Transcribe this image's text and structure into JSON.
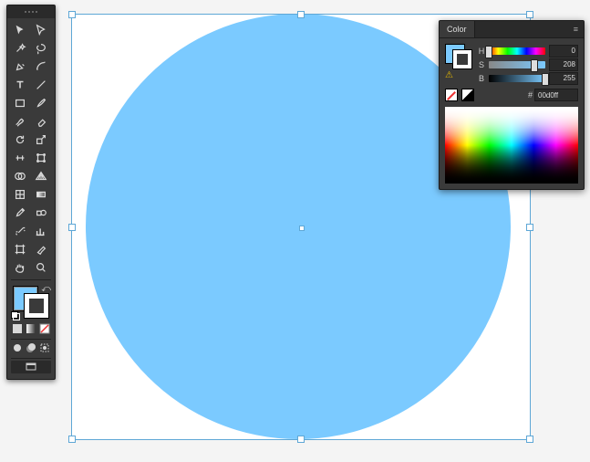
{
  "canvas": {
    "shape": "ellipse",
    "fill_color": "#7bcaff",
    "stroke": "none"
  },
  "toolbar": {
    "rows": [
      [
        "selection-tool",
        "direct-selection-tool"
      ],
      [
        "magic-wand-tool",
        "lasso-tool"
      ],
      [
        "pen-tool",
        "curvature-tool"
      ],
      [
        "type-tool",
        "line-segment-tool"
      ],
      [
        "rectangle-tool",
        "paintbrush-tool"
      ],
      [
        "shaper-tool",
        "eraser-tool"
      ],
      [
        "rotate-tool",
        "scale-tool"
      ],
      [
        "width-tool",
        "free-transform-tool"
      ],
      [
        "shape-builder-tool",
        "perspective-grid-tool"
      ],
      [
        "mesh-tool",
        "gradient-tool"
      ],
      [
        "eyedropper-tool",
        "blend-tool"
      ],
      [
        "symbol-sprayer-tool",
        "column-graph-tool"
      ],
      [
        "artboard-tool",
        "slice-tool"
      ],
      [
        "hand-tool",
        "zoom-tool"
      ]
    ],
    "fill_color": "#7bcaff",
    "stroke_color": "none",
    "draw_modes": [
      "draw-normal",
      "draw-behind",
      "draw-inside"
    ],
    "screen_modes": [
      "change-screen-mode"
    ]
  },
  "colorPanel": {
    "tab": "Color",
    "model": "HSB",
    "h": {
      "label": "H",
      "value": 0,
      "max": 360
    },
    "s": {
      "label": "S",
      "value": 208,
      "max": 255
    },
    "b": {
      "label": "B",
      "value": 255,
      "max": 255
    },
    "hex_label": "#",
    "hex": "00d0ff",
    "fill_swatch": "#7bcaff",
    "stroke_swatch": "none"
  }
}
